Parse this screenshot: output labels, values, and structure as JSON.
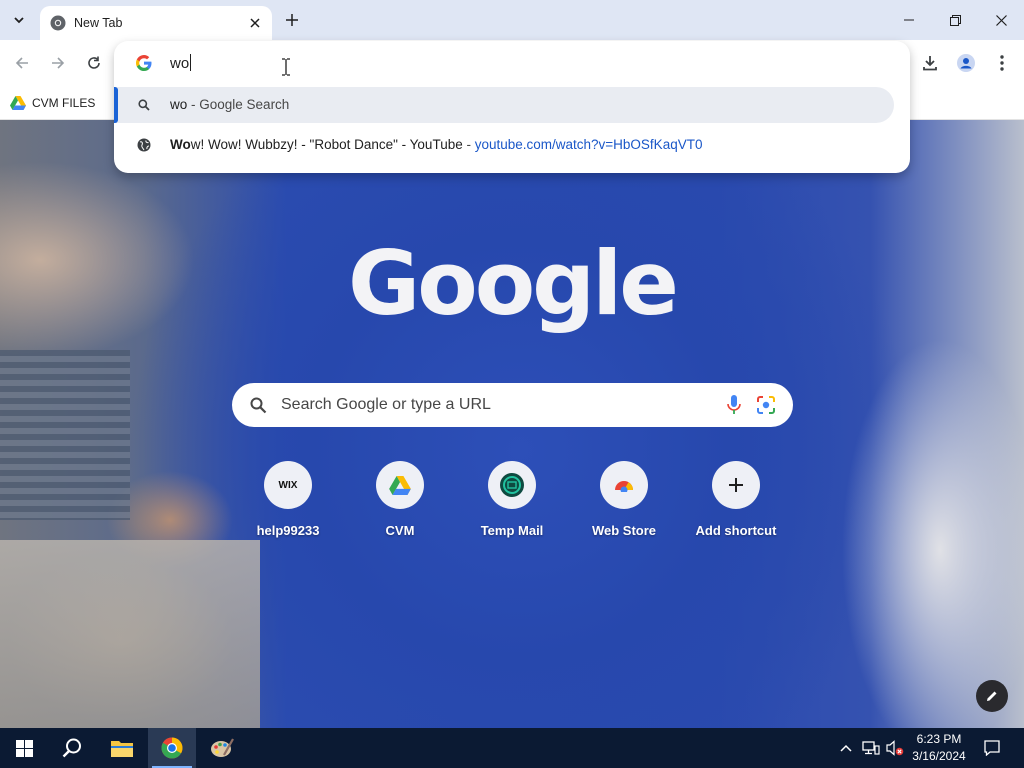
{
  "browser": {
    "tab": {
      "title": "New Tab"
    },
    "bookmarks": [
      {
        "label": "CVM FILES"
      }
    ]
  },
  "omnibox": {
    "input_value": "wo",
    "suggestions": [
      {
        "type": "search",
        "icon": "search-icon",
        "query": "wo",
        "suffix": " - Google Search"
      },
      {
        "type": "history",
        "icon": "globe-icon",
        "match": "Wo",
        "title_rest": "w! Wow! Wubbzy! - \"Robot Dance\" - YouTube",
        "separator": " - ",
        "url": "youtube.com/watch?v=HbOSfKaqVT0"
      }
    ]
  },
  "new_tab_page": {
    "logo": "Google",
    "search_placeholder": "Search Google or type a URL",
    "shortcuts": [
      {
        "label": "help99233",
        "icon": "wix-icon",
        "icon_text": "WIX"
      },
      {
        "label": "CVM",
        "icon": "google-drive-icon"
      },
      {
        "label": "Temp Mail",
        "icon": "temp-mail-icon"
      },
      {
        "label": "Web Store",
        "icon": "chrome-web-store-icon"
      },
      {
        "label": "Add shortcut",
        "icon": "plus-icon"
      }
    ]
  },
  "taskbar": {
    "time": "6:23 PM",
    "date": "3/16/2024"
  },
  "colors": {
    "accent": "#1a63d6",
    "url": "#1a57c8",
    "taskbar": "#0b1a33",
    "hoodie_blue": "#2a4aaf"
  }
}
